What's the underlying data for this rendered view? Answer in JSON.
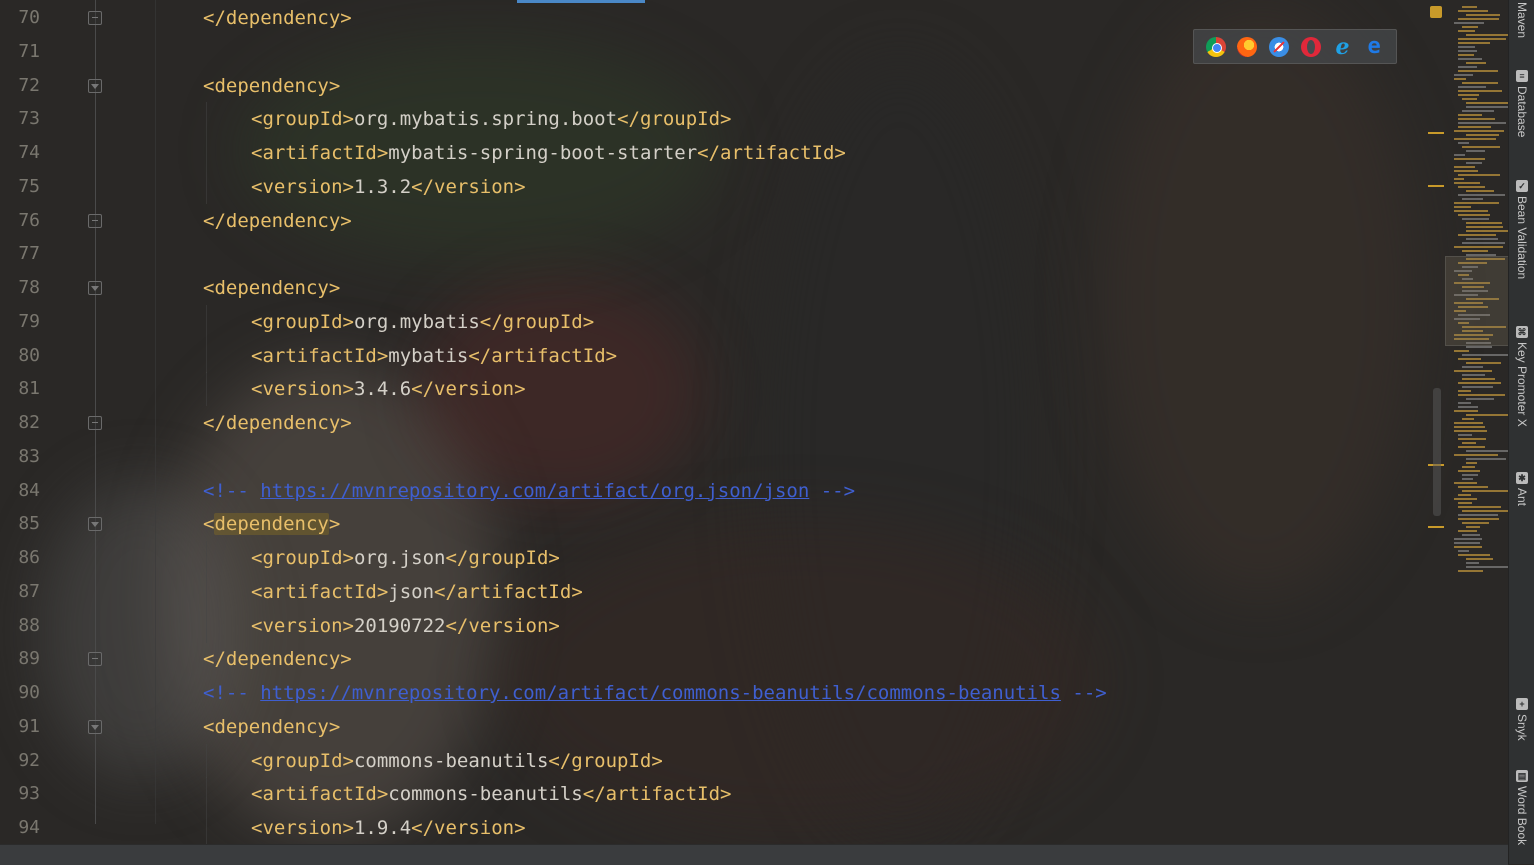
{
  "editor": {
    "lines": [
      {
        "num": "70",
        "indent": 1,
        "parts": [
          {
            "t": "tag",
            "v": "</dependency>"
          }
        ],
        "fold": "up"
      },
      {
        "num": "71",
        "indent": 0,
        "parts": []
      },
      {
        "num": "72",
        "indent": 1,
        "parts": [
          {
            "t": "tag",
            "v": "<dependency>"
          }
        ],
        "fold": "down"
      },
      {
        "num": "73",
        "indent": 2,
        "parts": [
          {
            "t": "tag",
            "v": "<groupId>"
          },
          {
            "t": "txt",
            "v": "org.mybatis.spring.boot"
          },
          {
            "t": "tag",
            "v": "</groupId>"
          }
        ]
      },
      {
        "num": "74",
        "indent": 2,
        "parts": [
          {
            "t": "tag",
            "v": "<artifactId>"
          },
          {
            "t": "txt",
            "v": "mybatis-spring-boot-starter"
          },
          {
            "t": "tag",
            "v": "</artifactId>"
          }
        ]
      },
      {
        "num": "75",
        "indent": 2,
        "parts": [
          {
            "t": "tag",
            "v": "<version>"
          },
          {
            "t": "txt",
            "v": "1.3.2"
          },
          {
            "t": "tag",
            "v": "</version>"
          }
        ]
      },
      {
        "num": "76",
        "indent": 1,
        "parts": [
          {
            "t": "tag",
            "v": "</dependency>"
          }
        ],
        "fold": "up"
      },
      {
        "num": "77",
        "indent": 0,
        "parts": []
      },
      {
        "num": "78",
        "indent": 1,
        "parts": [
          {
            "t": "tag",
            "v": "<dependency>"
          }
        ],
        "fold": "down"
      },
      {
        "num": "79",
        "indent": 2,
        "parts": [
          {
            "t": "tag",
            "v": "<groupId>"
          },
          {
            "t": "txt",
            "v": "org.mybatis"
          },
          {
            "t": "tag",
            "v": "</groupId>"
          }
        ]
      },
      {
        "num": "80",
        "indent": 2,
        "parts": [
          {
            "t": "tag",
            "v": "<artifactId>"
          },
          {
            "t": "txt",
            "v": "mybatis"
          },
          {
            "t": "tag",
            "v": "</artifactId>"
          }
        ]
      },
      {
        "num": "81",
        "indent": 2,
        "parts": [
          {
            "t": "tag",
            "v": "<version>"
          },
          {
            "t": "txt",
            "v": "3.4.6"
          },
          {
            "t": "tag",
            "v": "</version>"
          }
        ]
      },
      {
        "num": "82",
        "indent": 1,
        "parts": [
          {
            "t": "tag",
            "v": "</dependency>"
          }
        ],
        "fold": "up"
      },
      {
        "num": "83",
        "indent": 0,
        "parts": []
      },
      {
        "num": "84",
        "indent": 1,
        "parts": [
          {
            "t": "cmt",
            "v": "<!-- "
          },
          {
            "t": "url",
            "v": "https://mvnrepository.com/artifact/org.json/json"
          },
          {
            "t": "cmt",
            "v": " -->"
          }
        ]
      },
      {
        "num": "85",
        "indent": 1,
        "parts": [
          {
            "t": "tag",
            "v": "<"
          },
          {
            "t": "taghl",
            "v": "dependency"
          },
          {
            "t": "tag",
            "v": ">"
          }
        ],
        "fold": "down"
      },
      {
        "num": "86",
        "indent": 2,
        "parts": [
          {
            "t": "tag",
            "v": "<groupId>"
          },
          {
            "t": "txt",
            "v": "org.json"
          },
          {
            "t": "tag",
            "v": "</groupId>"
          }
        ]
      },
      {
        "num": "87",
        "indent": 2,
        "parts": [
          {
            "t": "tag",
            "v": "<artifactId>"
          },
          {
            "t": "txt",
            "v": "json"
          },
          {
            "t": "tag",
            "v": "</artifactId>"
          }
        ]
      },
      {
        "num": "88",
        "indent": 2,
        "parts": [
          {
            "t": "tag",
            "v": "<version>"
          },
          {
            "t": "txt",
            "v": "20190722"
          },
          {
            "t": "tag",
            "v": "</version>"
          }
        ]
      },
      {
        "num": "89",
        "indent": 1,
        "parts": [
          {
            "t": "tag",
            "v": "</dependency>"
          }
        ],
        "fold": "up"
      },
      {
        "num": "90",
        "indent": 1,
        "parts": [
          {
            "t": "cmt",
            "v": "<!-- "
          },
          {
            "t": "url",
            "v": "https://mvnrepository.com/artifact/commons-beanutils/commons-beanutils"
          },
          {
            "t": "cmt",
            "v": " -->"
          }
        ]
      },
      {
        "num": "91",
        "indent": 1,
        "parts": [
          {
            "t": "tag",
            "v": "<dependency>"
          }
        ],
        "fold": "down"
      },
      {
        "num": "92",
        "indent": 2,
        "parts": [
          {
            "t": "tag",
            "v": "<groupId>"
          },
          {
            "t": "txt",
            "v": "commons-beanutils"
          },
          {
            "t": "tag",
            "v": "</groupId>"
          }
        ]
      },
      {
        "num": "93",
        "indent": 2,
        "parts": [
          {
            "t": "tag",
            "v": "<artifactId>"
          },
          {
            "t": "txt",
            "v": "commons-beanutils"
          },
          {
            "t": "tag",
            "v": "</artifactId>"
          }
        ]
      },
      {
        "num": "94",
        "indent": 2,
        "parts": [
          {
            "t": "tag",
            "v": "<version>"
          },
          {
            "t": "txt",
            "v": "1.9.4"
          },
          {
            "t": "tag",
            "v": "</version>"
          }
        ]
      }
    ]
  },
  "browser_icons": [
    "chrome-icon",
    "firefox-icon",
    "safari-icon",
    "opera-icon",
    "internet-explorer-icon",
    "edge-icon"
  ],
  "tool_windows": [
    {
      "label": "Maven",
      "icon": "maven-icon"
    },
    {
      "label": "Database",
      "icon": "database-icon"
    },
    {
      "label": "Bean Validation",
      "icon": "bean-validation-icon"
    },
    {
      "label": "Key Promoter X",
      "icon": "key-promoter-icon"
    },
    {
      "label": "Ant",
      "icon": "ant-icon"
    },
    {
      "label": "Snyk",
      "icon": "snyk-icon"
    },
    {
      "label": "Word Book",
      "icon": "word-book-icon"
    }
  ],
  "colors": {
    "tag": "#e8bf6a",
    "text": "#d4d0c8",
    "comment": "#3f5fd0",
    "line_number": "#7a776f",
    "warning_marker": "#c89a2a"
  }
}
